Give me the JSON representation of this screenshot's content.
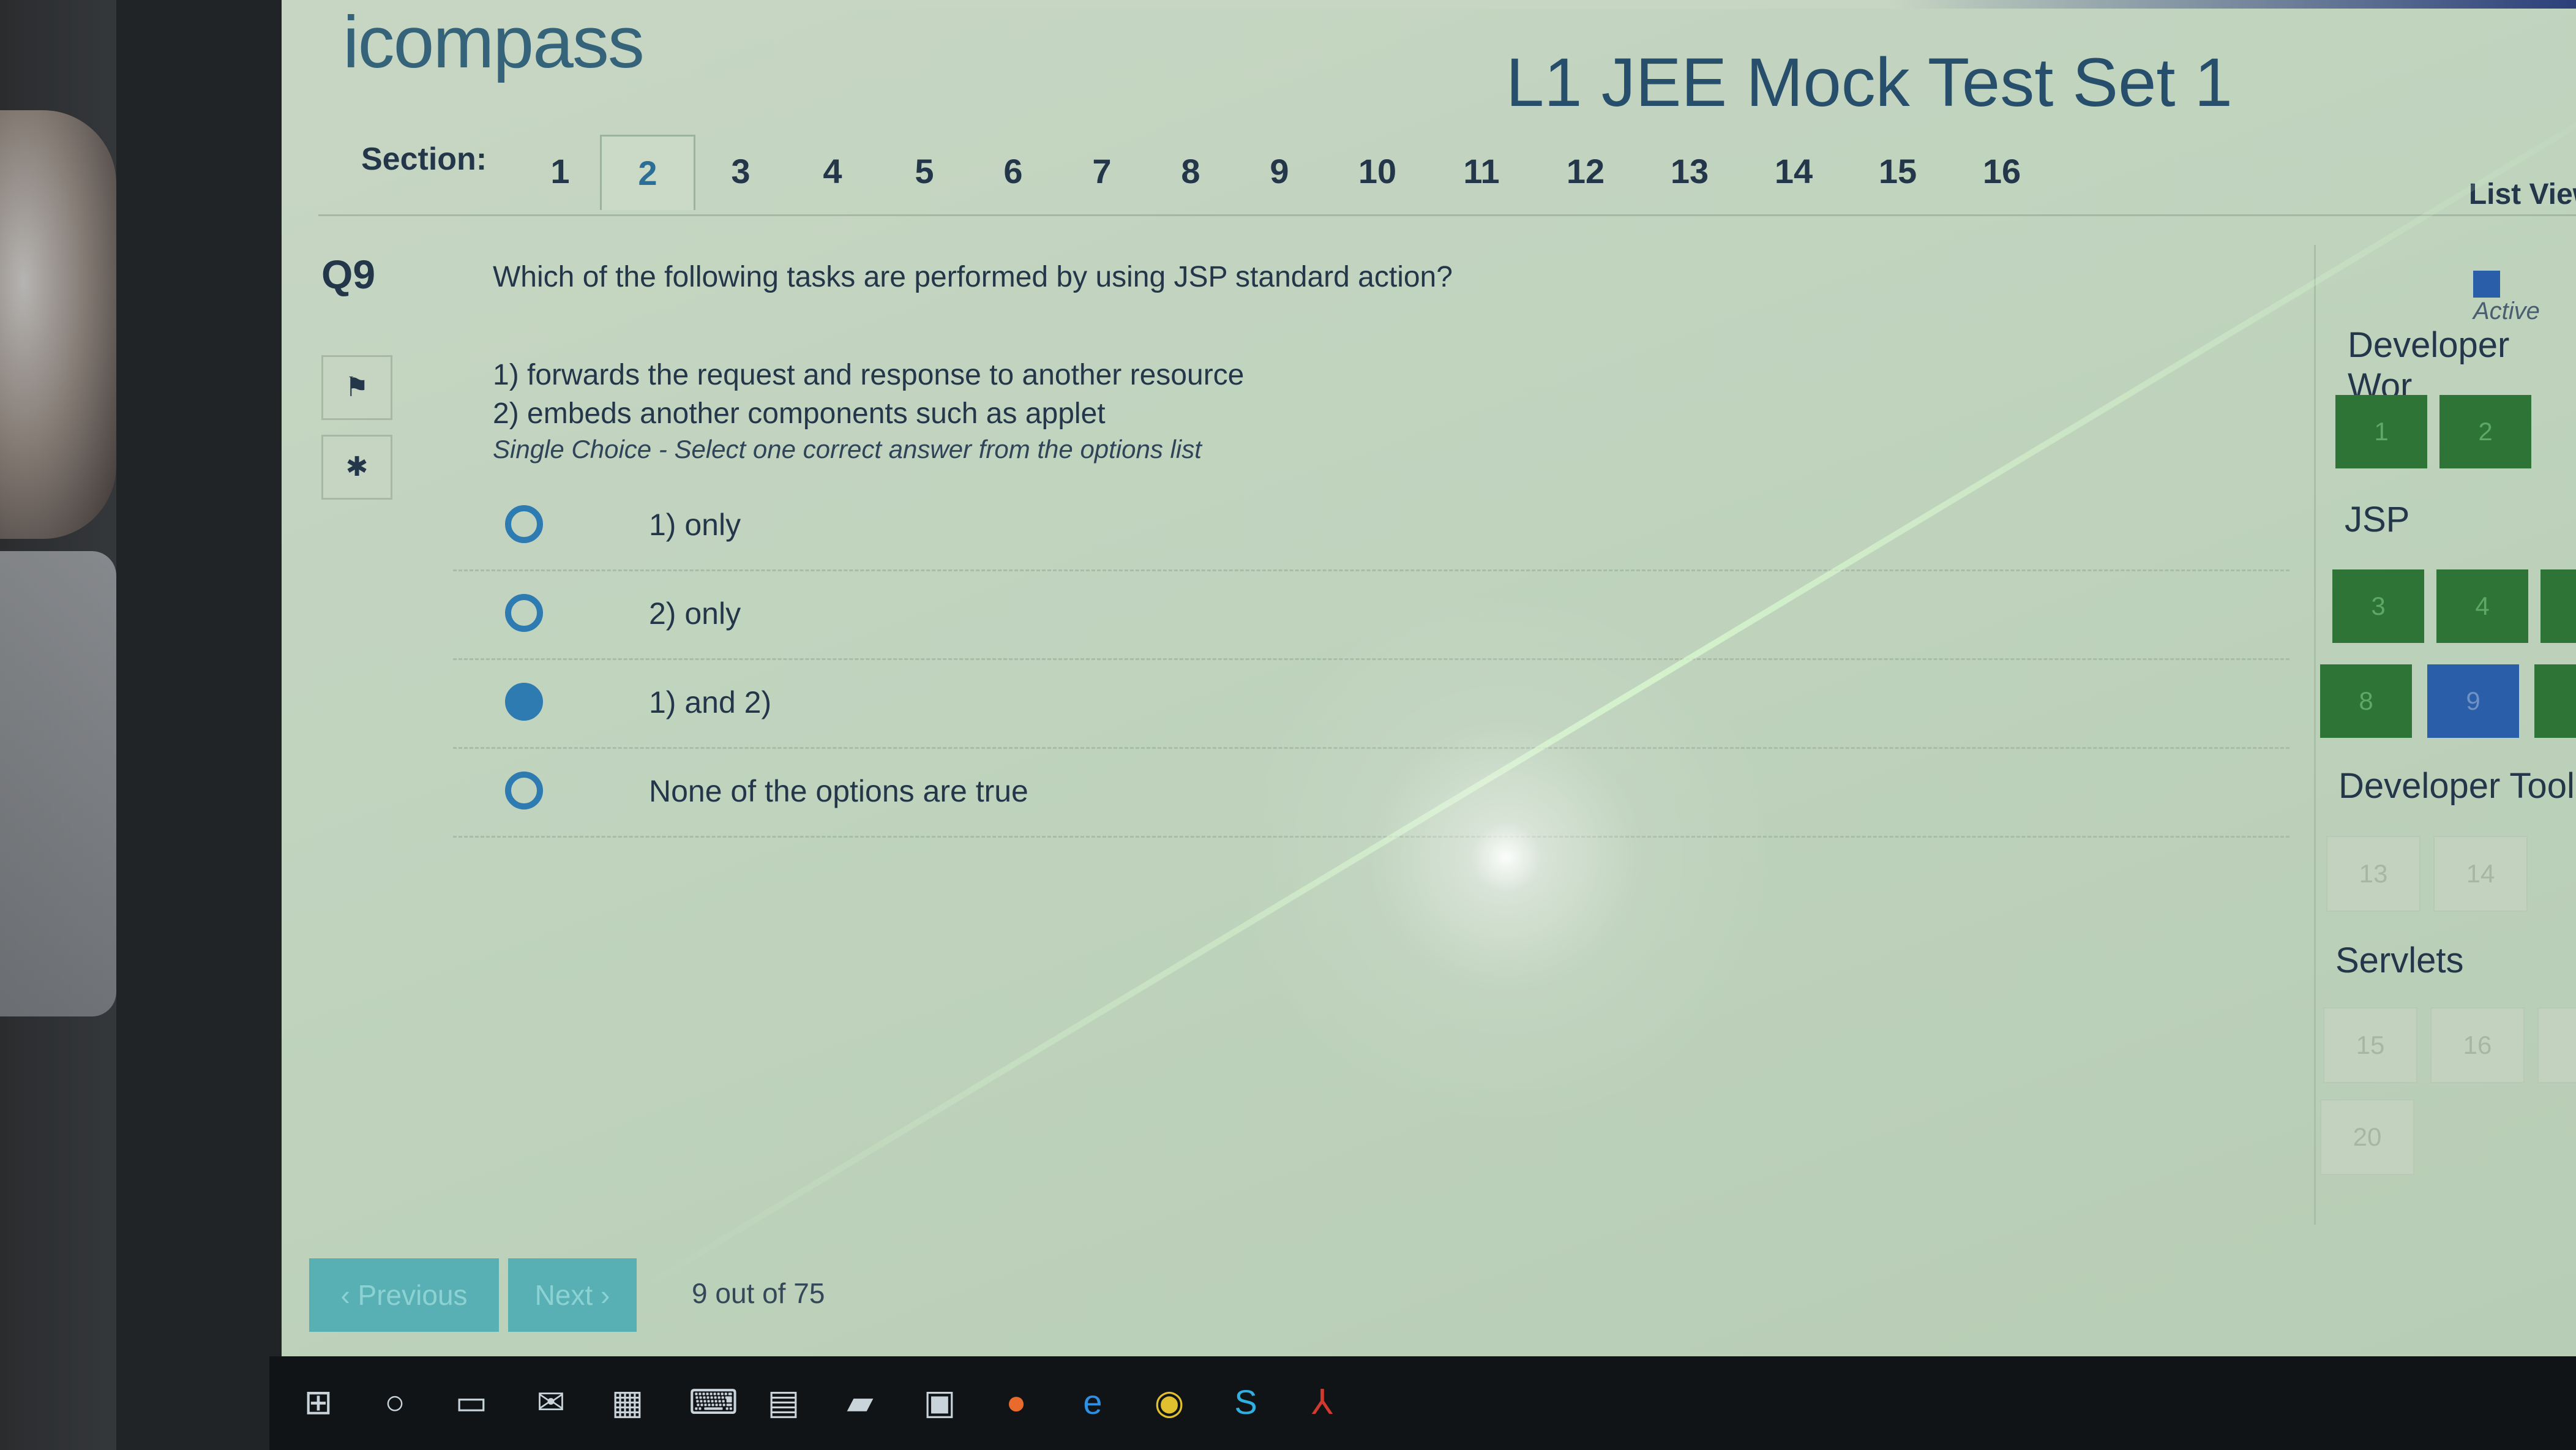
{
  "app": {
    "logo": "icompass",
    "title": "L1 JEE Mock Test Set 1"
  },
  "sections": {
    "label": "Section:",
    "tabs": [
      "1",
      "2",
      "3",
      "4",
      "5",
      "6",
      "7",
      "8",
      "9",
      "10",
      "11",
      "12",
      "13",
      "14",
      "15",
      "16"
    ],
    "active": "2",
    "list_view": "List View"
  },
  "question": {
    "number": "Q9",
    "text": "Which of the following tasks are performed by using JSP standard action?",
    "statements": [
      "1) forwards the request and response to another resource",
      "2) embeds another components such as applet"
    ],
    "hint": "Single Choice - Select one correct answer from the options list",
    "options": [
      {
        "label": "1) only",
        "selected": false
      },
      {
        "label": "2) only",
        "selected": false
      },
      {
        "label": "1) and 2)",
        "selected": true
      },
      {
        "label": "None of the options are true",
        "selected": false
      }
    ]
  },
  "side_buttons": {
    "flag_icon": "flag-icon",
    "bug_icon": "bug-icon"
  },
  "panel": {
    "legend_active": "Active",
    "groups": [
      {
        "title": "Developer Wor",
        "questions": [
          "1",
          "2"
        ]
      },
      {
        "title": "JSP",
        "questions": [
          "3",
          "4",
          "8",
          "9"
        ]
      },
      {
        "title": "Developer Tool",
        "questions": [
          "13",
          "14"
        ]
      },
      {
        "title": "Servlets",
        "questions": [
          "15",
          "16",
          "20"
        ]
      }
    ]
  },
  "footer": {
    "previous": "‹ Previous",
    "next": "Next ›",
    "progress": "9 out of 75"
  },
  "colors": {
    "answered": "#2f7437",
    "current": "#2a5ea8",
    "accent": "#2e7bb2",
    "footer_button": "#58b0b4"
  }
}
